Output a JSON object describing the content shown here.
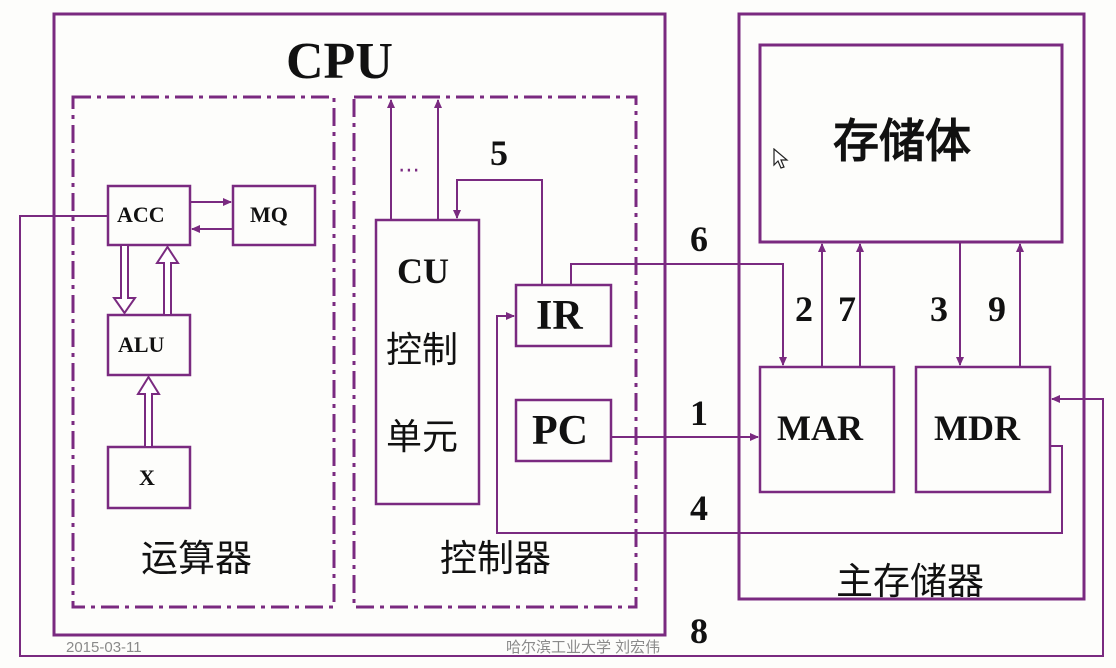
{
  "diagram": {
    "cpu_title": "CPU",
    "arithmetic_unit": {
      "acc": "ACC",
      "mq": "MQ",
      "alu": "ALU",
      "x": "X",
      "caption": "运算器"
    },
    "control_unit": {
      "cu_line1": "CU",
      "cu_line2": "控制",
      "cu_line3": "单元",
      "ellipsis": "⋯",
      "ir": "IR",
      "pc": "PC",
      "caption": "控制器"
    },
    "main_memory": {
      "storage": "存储体",
      "mar": "MAR",
      "mdr": "MDR",
      "caption": "主存储器"
    },
    "step_labels": {
      "s1": "1",
      "s2": "2",
      "s3": "3",
      "s4": "4",
      "s5": "5",
      "s6": "6",
      "s7": "7",
      "s8": "8",
      "s9": "9"
    },
    "colors": {
      "line": "#7a2a80",
      "background": "#fdfdfb"
    }
  },
  "footer": {
    "date": "2015-03-11",
    "credit": "哈尔滨工业大学  刘宏伟"
  }
}
